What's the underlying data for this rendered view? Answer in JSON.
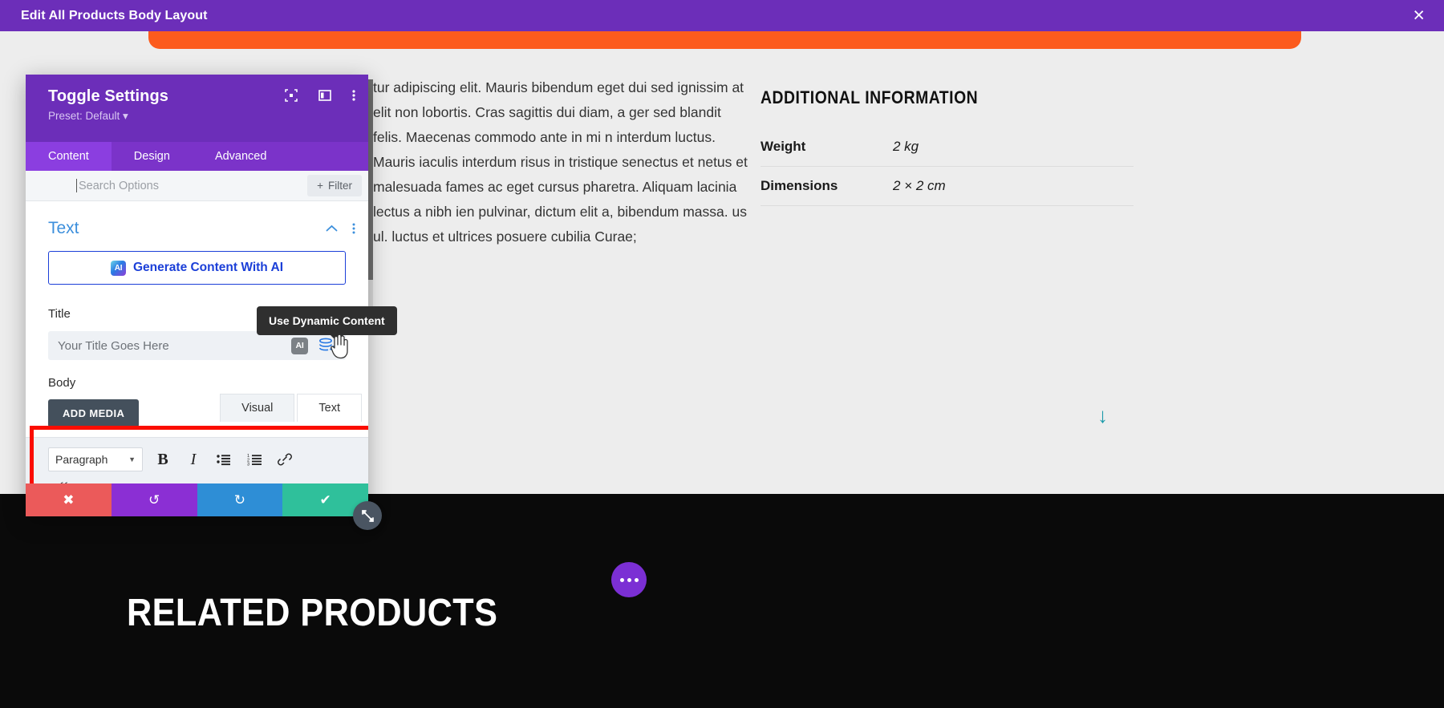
{
  "top_bar": {
    "title": "Edit All Products Body Layout",
    "close_label": "×"
  },
  "modal": {
    "title": "Toggle Settings",
    "preset": "Preset: Default ▾",
    "header_icons": [
      "expand-icon",
      "layout-icon",
      "kebab-icon"
    ],
    "tabs": [
      {
        "label": "Content",
        "active": true
      },
      {
        "label": "Design",
        "active": false
      },
      {
        "label": "Advanced",
        "active": false
      }
    ],
    "search": {
      "placeholder": "Search Options",
      "value": "",
      "filter_label": "Filter",
      "filter_plus": "+"
    },
    "section": {
      "title": "Text",
      "collapse_icon": "⌃",
      "kebab_icon": "⋮"
    },
    "ai_generate": {
      "label": "Generate Content With AI",
      "badge": "AI"
    },
    "title_field": {
      "label": "Title",
      "placeholder": "Your Title Goes Here",
      "value": "",
      "ai_badge": "AI",
      "dynamic_icon": "dynamic-content-icon"
    },
    "tooltip": {
      "text": "Use Dynamic Content"
    },
    "body_field": {
      "label": "Body",
      "add_media_label": "ADD MEDIA",
      "editor_tabs": [
        {
          "label": "Visual",
          "active": true
        },
        {
          "label": "Text",
          "active": false
        }
      ],
      "format_select": "Paragraph",
      "toolbar_row1": [
        "bold-icon",
        "italic-icon",
        "bulleted-list-icon",
        "numbered-list-icon",
        "link-icon"
      ],
      "toolbar_row2": [
        "blockquote-icon",
        "align-left-icon",
        "align-center-icon",
        "align-right-icon",
        "align-justify-icon",
        "table-icon",
        "strikethrough-icon",
        "underline-icon"
      ]
    },
    "actions": [
      {
        "name": "cancel",
        "icon": "✖",
        "color": "#eb5a5a"
      },
      {
        "name": "undo",
        "icon": "↺",
        "color": "#8b2fd4"
      },
      {
        "name": "redo",
        "icon": "↻",
        "color": "#2e8ed6"
      },
      {
        "name": "save",
        "icon": "✔",
        "color": "#2fc09b"
      }
    ],
    "resize_handle_icon": "resize-icon"
  },
  "page": {
    "body_paragraph": "tur adipiscing elit. Mauris bibendum eget dui sed ignissim at elit non lobortis. Cras sagittis dui diam, a ger sed blandit felis. Maecenas commodo ante in mi n interdum luctus. Mauris iaculis interdum risus in  tristique senectus et netus et malesuada fames ac eget cursus pharetra. Aliquam lacinia lectus a nibh ien pulvinar, dictum elit a, bibendum massa. us ul. luctus et ultrices posuere cubilia Curae;",
    "additional_information": {
      "heading": "ADDITIONAL INFORMATION",
      "rows": [
        {
          "key": "Weight",
          "value": "2 kg"
        },
        {
          "key": "Dimensions",
          "value": "2 × 2 cm"
        }
      ]
    },
    "scroll_down_icon": "↓",
    "related_products_heading": "RELATED PRODUCTS",
    "dots_button": "ellipsis-button"
  },
  "colors": {
    "brand_purple": "#6c2eb9",
    "accent_orange": "#fc5b1d",
    "highlight_red": "#fb0d00",
    "link_blue": "#3c8fdc",
    "teal": "#1b9aaa"
  }
}
